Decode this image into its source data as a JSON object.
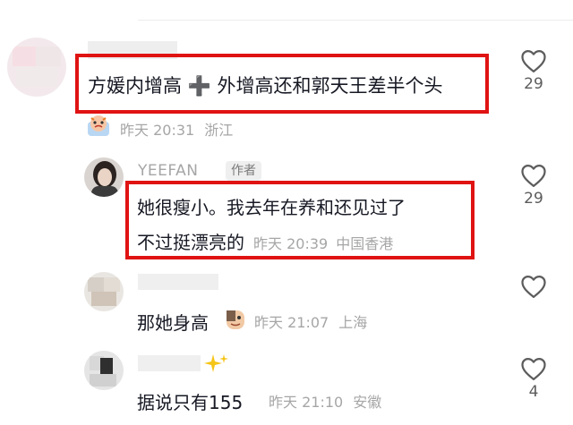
{
  "comments": [
    {
      "text": "方媛内增高 ➕ 外增高还和郭天王差半个头",
      "time": "昨天 20:31",
      "location": "浙江",
      "likes": "29"
    },
    {
      "username": "YEEFAN",
      "tag": "作者",
      "text_line1": "她很瘦小。我去年在养和还见过了",
      "text_line2": "不过挺漂亮的",
      "time": "昨天 20:39",
      "location": "中国香港",
      "likes": "29"
    },
    {
      "text": "那她身高",
      "time": "昨天 21:07",
      "location": "上海"
    },
    {
      "text": "据说只有155",
      "time": "昨天 21:10",
      "location": "安徽",
      "likes": "4"
    }
  ],
  "icons": {
    "like": "heart-outline-icon"
  },
  "colors": {
    "highlight": "#e01313",
    "meta": "#a6a6a6"
  }
}
